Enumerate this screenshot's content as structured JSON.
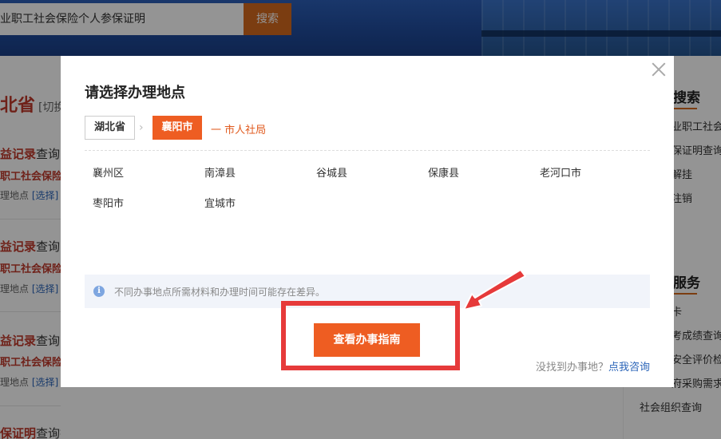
{
  "search": {
    "query": "业职工社会保险个人参保证明",
    "button_label": "搜索"
  },
  "left": {
    "province": "北省",
    "province_switch": "[切换",
    "items": [
      {
        "title_hl": "益记录",
        "title_rest": "查询",
        "subtitle": "职工社会保险",
        "loc_label": "理地点",
        "loc_link": "[选择]"
      },
      {
        "title_hl": "益记录",
        "title_rest": "查询",
        "subtitle": "职工社会保险",
        "loc_label": "理地点",
        "loc_link": "[选择]"
      },
      {
        "title_hl": "益记录",
        "title_rest": "查询",
        "subtitle": "职工社会保险",
        "loc_label": "理地点",
        "loc_link": "[选择]"
      },
      {
        "title_hl": "保证明",
        "title_rest": "查询打印"
      }
    ]
  },
  "right": {
    "heading1": "搜索",
    "links1": [
      "业职工社会",
      "保证明查询",
      "解挂",
      "注销"
    ],
    "heading2": "服务",
    "links2": [
      "卡",
      "考成绩查询",
      "安全评价检",
      "府采购需求"
    ],
    "last_link": "社会组织查询"
  },
  "modal": {
    "title": "请选择办理地点",
    "breadcrumb": {
      "province": "湖北省",
      "arrow": "›",
      "city": "襄阳市",
      "department": "一 市人社局"
    },
    "counties": [
      "襄州区",
      "南漳县",
      "谷城县",
      "保康县",
      "老河口市",
      "枣阳市",
      "宜城市"
    ],
    "notice": {
      "icon": "i",
      "text": "不同办事地点所需材料和办理时间可能存在差异。"
    },
    "guide_button": "查看办事指南",
    "help": {
      "prefix": "没找到办事地？",
      "link": "点我咨询"
    }
  },
  "colors": {
    "accent": "#ee5d22",
    "link": "#2a64b8",
    "highlight": "#e63a3a"
  }
}
